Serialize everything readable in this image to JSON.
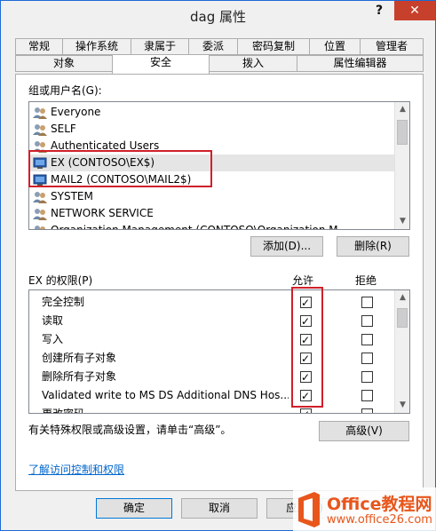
{
  "window": {
    "title": "dag 属性",
    "help_label": "?",
    "close_label": "✕"
  },
  "tabs_row1": [
    "常规",
    "操作系统",
    "隶属于",
    "委派",
    "密码复制",
    "位置",
    "管理者"
  ],
  "tabs_row2": [
    "对象",
    "安全",
    "拨入",
    "属性编辑器"
  ],
  "active_tab": "安全",
  "groups": {
    "label": "组或用户名(G):",
    "items": [
      {
        "name": "Everyone",
        "type": "group"
      },
      {
        "name": "SELF",
        "type": "group"
      },
      {
        "name": "Authenticated Users",
        "type": "group"
      },
      {
        "name": "EX (CONTOSO\\EX$)",
        "type": "computer"
      },
      {
        "name": "MAIL2 (CONTOSO\\MAIL2$)",
        "type": "computer"
      },
      {
        "name": "SYSTEM",
        "type": "group"
      },
      {
        "name": "NETWORK SERVICE",
        "type": "group"
      },
      {
        "name": "Organization Management (CONTOSO\\Organization M...",
        "type": "group"
      }
    ],
    "selected_index": 3,
    "add_button": "添加(D)...",
    "remove_button": "删除(R)"
  },
  "permissions": {
    "label": "EX 的权限(P)",
    "allow_header": "允许",
    "deny_header": "拒绝",
    "rows": [
      {
        "name": "完全控制",
        "allow": true,
        "deny": false
      },
      {
        "name": "读取",
        "allow": true,
        "deny": false
      },
      {
        "name": "写入",
        "allow": true,
        "deny": false
      },
      {
        "name": "创建所有子对象",
        "allow": true,
        "deny": false
      },
      {
        "name": "删除所有子对象",
        "allow": true,
        "deny": false
      },
      {
        "name": "Validated write to MS DS Additional DNS Hos...",
        "allow": true,
        "deny": false
      },
      {
        "name": "更改密码",
        "allow": true,
        "deny": false
      }
    ]
  },
  "advanced": {
    "text": "有关特殊权限或高级设置，请单击“高级”。",
    "button": "高级(V)"
  },
  "help_link": "了解访问控制和权限",
  "footer": {
    "ok": "确定",
    "cancel": "取消",
    "apply": "应用(A)"
  },
  "watermark": {
    "brand": "Office教程网",
    "url": "www.office26.com"
  },
  "colors": {
    "highlight_box": "#d0202a",
    "close_button": "#c7402c",
    "link": "#0066cc",
    "watermark_orange": "#e8561c"
  }
}
